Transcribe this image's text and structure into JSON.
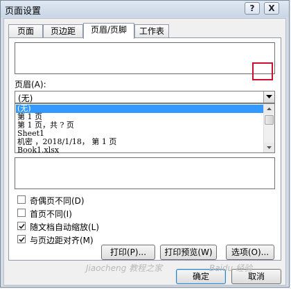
{
  "window": {
    "title": "页面设置",
    "help_label": "?",
    "close_label": "X"
  },
  "tabs": [
    {
      "label": "页面"
    },
    {
      "label": "页边距"
    },
    {
      "label": "页眉/页脚"
    },
    {
      "label": "工作表"
    }
  ],
  "header": {
    "label": "页眉(A):",
    "selected_value": "(无)",
    "options": [
      "(无)",
      "第 1 页",
      "第 1 页，共 ? 页",
      "Sheet1",
      " 机密 ，2018/1/18， 第 1 页",
      "Book1.xlsx"
    ]
  },
  "checkboxes": [
    {
      "label": "奇偶页不同(D)",
      "checked": false
    },
    {
      "label": "首页不同(I)",
      "checked": false
    },
    {
      "label": "随文档自动缩放(L)",
      "checked": true
    },
    {
      "label": "与页边距对齐(M)",
      "checked": true
    }
  ],
  "buttons": {
    "print": "打印(P)...",
    "preview": "打印预览(W)",
    "options": "选项(O)...",
    "ok": "确定",
    "cancel": "取消"
  },
  "watermark": {
    "left": "Jiaocheng 教程之家",
    "right": "Baidu 经验"
  }
}
